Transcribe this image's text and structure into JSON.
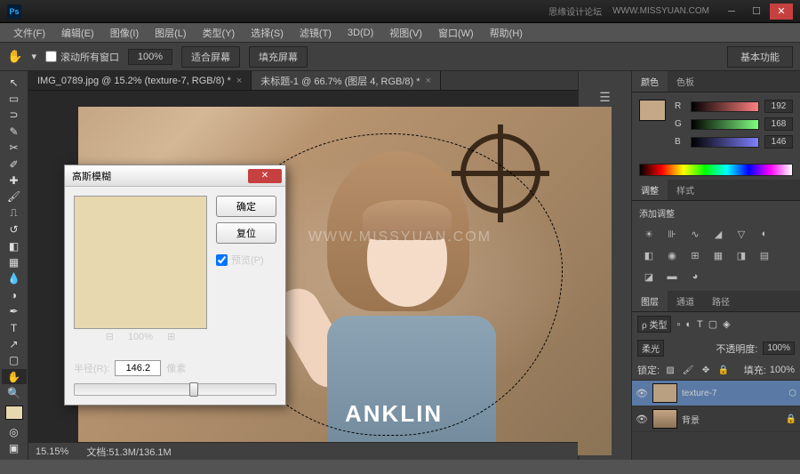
{
  "titlebar": {
    "brand": "思缘设计论坛",
    "url": "WWW.MISSYUAN.COM"
  },
  "menu": [
    "文件(F)",
    "编辑(E)",
    "图像(I)",
    "图层(L)",
    "类型(Y)",
    "选择(S)",
    "滤镜(T)",
    "3D(D)",
    "视图(V)",
    "窗口(W)",
    "帮助(H)"
  ],
  "options": {
    "scroll_all": "滚动所有窗口",
    "zoom": "100%",
    "fit_screen": "适合屏幕",
    "fill_screen": "填充屏幕",
    "workspace": "基本功能"
  },
  "doc_tabs": [
    {
      "label": "IMG_0789.jpg @ 15.2% (texture-7, RGB/8) *"
    },
    {
      "label": "未标题-1 @ 66.7% (图层 4, RGB/8) *"
    }
  ],
  "canvas": {
    "shirt_text": "ANKLIN"
  },
  "dialog": {
    "title": "高斯模糊",
    "ok": "确定",
    "reset": "复位",
    "preview": "预览(P)",
    "zoom": "100%",
    "radius_label": "半径(R):",
    "radius_value": "146.2",
    "radius_unit": "像素"
  },
  "status": {
    "zoom": "15.15%",
    "doc": "文档:51.3M/136.1M"
  },
  "panels": {
    "color_tab": "颜色",
    "swatch_tab": "色板",
    "r": "192",
    "g": "168",
    "b": "146",
    "adjust_tab": "调整",
    "style_tab": "样式",
    "adjust_title": "添加调整",
    "layers_tab": "图层",
    "channels_tab": "通道",
    "paths_tab": "路径",
    "kind": "ρ 类型",
    "blend": "柔光",
    "opacity_label": "不透明度:",
    "opacity": "100%",
    "lock_label": "锁定:",
    "fill_label": "填充:",
    "fill": "100%",
    "layer1": "texture-7",
    "layer2": "背景"
  },
  "watermark": "WWW.MISSYUAN.COM"
}
